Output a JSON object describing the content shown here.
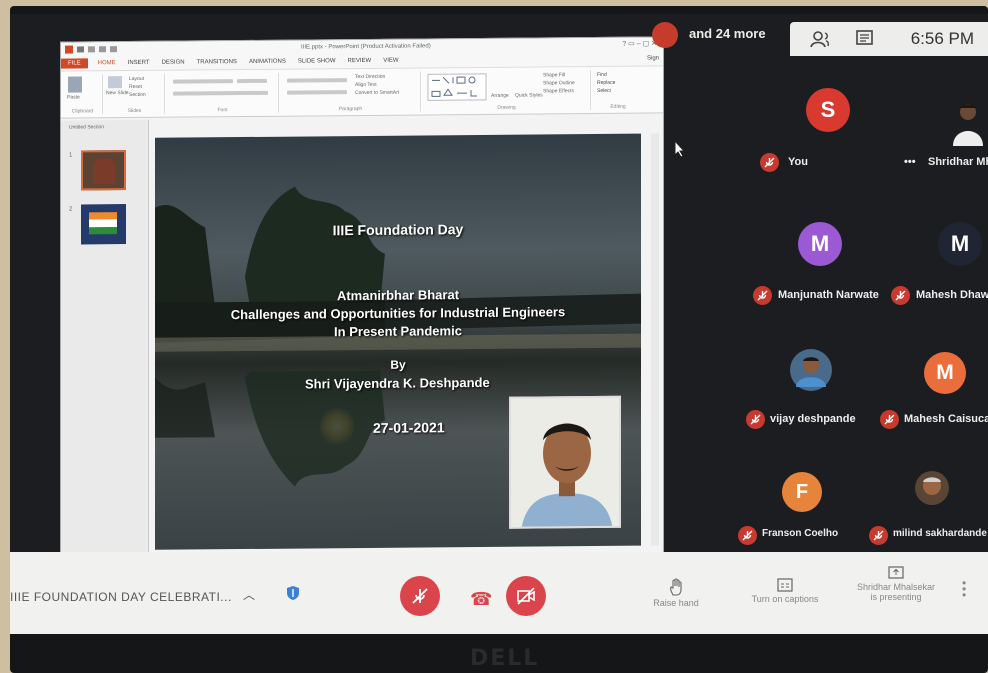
{
  "powerpoint": {
    "window_title": "IIIE.pptx - PowerPoint (Product Activation Failed)",
    "tabs": [
      "FILE",
      "HOME",
      "INSERT",
      "DESIGN",
      "TRANSITIONS",
      "ANIMATIONS",
      "SLIDE SHOW",
      "REVIEW",
      "VIEW"
    ],
    "ribbon_groups": [
      "Clipboard",
      "Slides",
      "Font",
      "Paragraph",
      "Drawing",
      "Editing"
    ],
    "ribbon_items": {
      "new_slide": "New Slide",
      "layout": "Layout",
      "reset": "Reset",
      "section": "Section",
      "text_direction": "Text Direction",
      "align_text": "Align Text",
      "convert_smartart": "Convert to SmartArt",
      "arrange": "Arrange",
      "quick_styles": "Quick Styles",
      "shape_fill": "Shape Fill",
      "shape_outline": "Shape Outline",
      "shape_effects": "Shape Effects",
      "find": "Find",
      "replace": "Replace",
      "select": "Select",
      "paste": "Paste",
      "sign_in": "Sign"
    },
    "section_label": "Untitled Section",
    "slide_numbers": [
      "1",
      "2"
    ],
    "slide": {
      "line1": "IIIE Foundation Day",
      "line2": "Atmanirbhar Bharat",
      "line3": "Challenges and Opportunities for Industrial Engineers",
      "line4": "In Present Pandemic",
      "line5": "By",
      "line6": "Shri Vijayendra K. Deshpande",
      "line7": "27-01-2021"
    }
  },
  "meet": {
    "more_count": "and 24 more",
    "clock": "6:56 PM",
    "participants": [
      {
        "initial": "S",
        "name": "You",
        "color": "#d93a30"
      },
      {
        "initial": "",
        "name": "Shridhar Mha",
        "color": "#6a4a35"
      },
      {
        "initial": "M",
        "name": "Manjunath Narwate",
        "color": "#9b5ad4"
      },
      {
        "initial": "M",
        "name": "Mahesh Dhawal",
        "color": "#1f2533"
      },
      {
        "initial": "",
        "name": "vijay deshpande",
        "color": "#4a6a8a"
      },
      {
        "initial": "M",
        "name": "Mahesh Caisucar",
        "color": "#ec6d3c"
      },
      {
        "initial": "F",
        "name": "Franson Coelho",
        "color": "#e7843b"
      },
      {
        "initial": "",
        "name": "milind sakhardande",
        "color": "#5a4535"
      }
    ],
    "controls": {
      "meeting_name": "IIIE FOUNDATION DAY CELEBRATI...",
      "raise_hand": "Raise hand",
      "captions": "Turn on captions",
      "presenting_line1": "Shridhar Mhalsekar",
      "presenting_line2": "is presenting"
    }
  },
  "brand": "DELL"
}
